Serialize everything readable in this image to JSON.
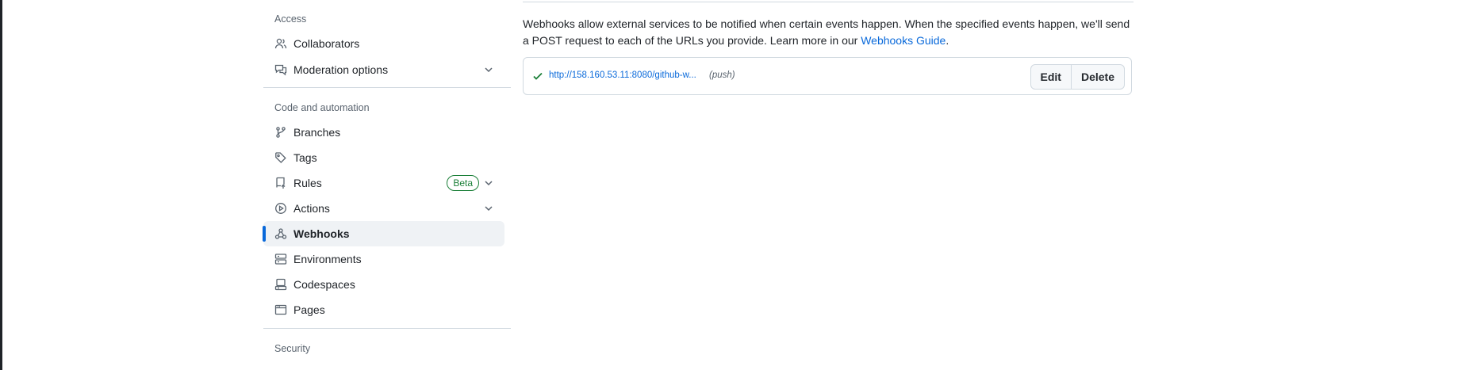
{
  "sidebar": {
    "access_heading": "Access",
    "access_items": [
      {
        "label": "Collaborators",
        "icon": "people-icon"
      },
      {
        "label": "Moderation options",
        "icon": "comment-discussion-icon",
        "expandable": true
      }
    ],
    "code_heading": "Code and automation",
    "code_items": [
      {
        "label": "Branches",
        "icon": "git-branch-icon"
      },
      {
        "label": "Tags",
        "icon": "tag-icon"
      },
      {
        "label": "Rules",
        "icon": "repo-push-icon",
        "badge": "Beta",
        "expandable": true
      },
      {
        "label": "Actions",
        "icon": "play-icon",
        "expandable": true
      },
      {
        "label": "Webhooks",
        "icon": "webhook-icon",
        "selected": true
      },
      {
        "label": "Environments",
        "icon": "server-icon"
      },
      {
        "label": "Codespaces",
        "icon": "codespaces-icon"
      },
      {
        "label": "Pages",
        "icon": "browser-icon"
      }
    ],
    "security_heading": "Security"
  },
  "main": {
    "description_text": "Webhooks allow external services to be notified when certain events happen. When the specified events happen, we'll send a POST request to each of the URLs you provide. Learn more in our ",
    "guide_link": "Webhooks Guide",
    "description_end": ".",
    "webhook": {
      "url": "http://158.160.53.11:8080/github-w...",
      "events": "(push)",
      "status": "success",
      "edit_label": "Edit",
      "delete_label": "Delete"
    }
  },
  "colors": {
    "accent": "#0969da",
    "success": "#1a7f37",
    "selected_bg": "#eff2f5",
    "border": "#d1d9e0"
  }
}
